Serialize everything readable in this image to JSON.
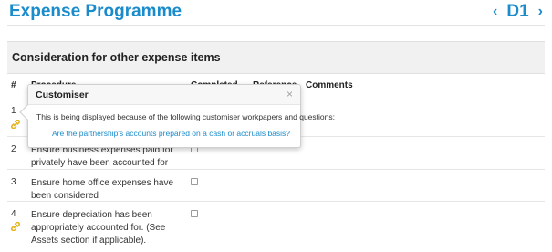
{
  "header": {
    "title": "Expense Programme",
    "nav_prev": "‹",
    "code": "D1",
    "nav_next": "›"
  },
  "section": {
    "title": "Consideration for other expense items"
  },
  "table": {
    "columns": {
      "num": "#",
      "procedure": "Procedure",
      "completed": "Completed",
      "reference": "Reference",
      "comments": "Comments"
    },
    "rows": [
      {
        "num": "1",
        "procedure": "",
        "completed": false,
        "has_link_icon": true
      },
      {
        "num": "2",
        "procedure": "Ensure business expenses paid for privately have been accounted for",
        "completed": false,
        "has_link_icon": false
      },
      {
        "num": "3",
        "procedure": "Ensure home office expenses have been considered",
        "completed": false,
        "has_link_icon": false
      },
      {
        "num": "4",
        "procedure": "Ensure depreciation has been appropriately accounted for. (See Assets section if applicable).",
        "completed": false,
        "has_link_icon": true
      }
    ]
  },
  "popover": {
    "title": "Customiser",
    "close": "×",
    "text": "This is being displayed because of the following customiser workpapers and questions:",
    "link": "Are the partnership's accounts prepared on a cash or accruals basis?"
  },
  "colors": {
    "accent": "#1a8bcb",
    "link_icon": "#e6b420",
    "section_bg": "#f1f1f1"
  },
  "icons": {
    "link": "link-icon",
    "prev": "chevron-left-icon",
    "next": "chevron-right-icon",
    "close": "close-icon"
  }
}
